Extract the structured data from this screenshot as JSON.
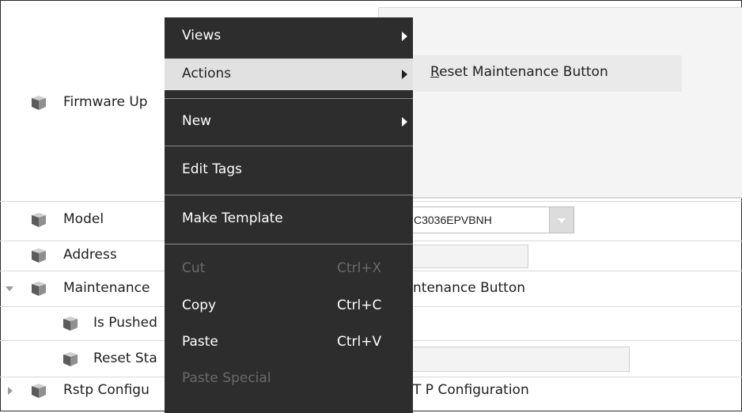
{
  "tree": {
    "rows": [
      {
        "label": "Firmware Up",
        "indent": 0
      },
      {
        "label": "Model",
        "indent": 0
      },
      {
        "label": "Address",
        "indent": 0
      },
      {
        "label": "Maintenance",
        "indent": 0
      },
      {
        "label": "Is Pushed",
        "indent": 1
      },
      {
        "label": "Reset Sta",
        "indent": 1
      },
      {
        "label": "Rstp Configu",
        "indent": 0
      }
    ],
    "icon": "component-cube-icon"
  },
  "values": {
    "model_select": "C3036EPVBNH",
    "maintenance_action": "ntenance Button",
    "rstp_value": "T P Configuration"
  },
  "context_menu": {
    "items": [
      {
        "label": "Views",
        "submenu": true
      },
      {
        "label": "Actions",
        "submenu": true
      },
      {
        "label": "New",
        "submenu": true
      },
      {
        "label": "Edit Tags"
      },
      {
        "label": "Make Template"
      },
      {
        "label": "Cut",
        "shortcut": "Ctrl+X",
        "disabled": true
      },
      {
        "label": "Copy",
        "shortcut": "Ctrl+C"
      },
      {
        "label": "Paste",
        "shortcut": "Ctrl+V"
      },
      {
        "label": "Paste Special",
        "disabled": true
      }
    ]
  },
  "submenu": {
    "item_first_letter": "R",
    "item_rest": "eset Maintenance Button"
  },
  "colors": {
    "menu_bg": "#2d2d2d",
    "menu_active_bg": "#e1e1e1",
    "menu_disabled_text": "#6a6a6a",
    "submenu_bg": "#eaeaea"
  }
}
